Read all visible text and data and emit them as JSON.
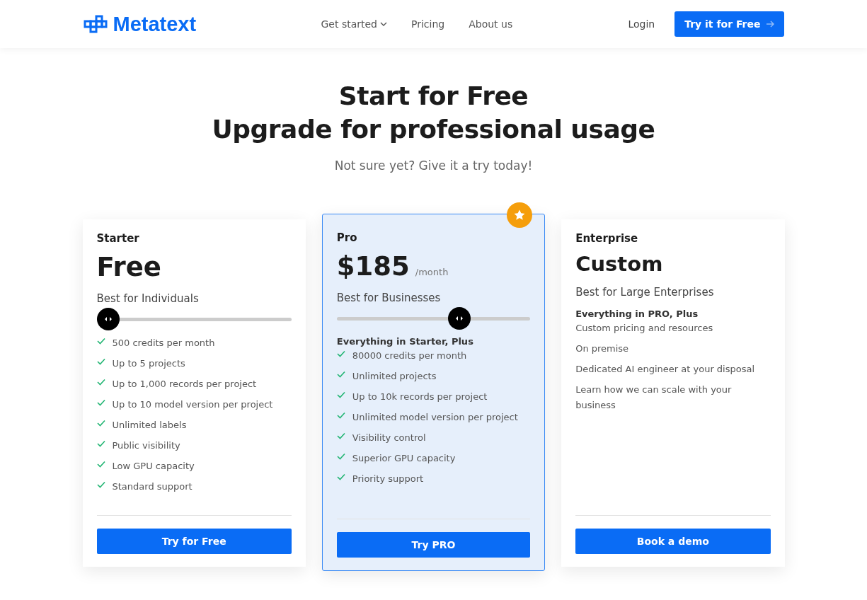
{
  "header": {
    "logo": "Metatext",
    "nav": [
      {
        "label": "Get started",
        "dropdown": true
      },
      {
        "label": "Pricing",
        "dropdown": false
      },
      {
        "label": "About us",
        "dropdown": false
      }
    ],
    "login": "Login",
    "cta": "Try it for Free"
  },
  "hero": {
    "title_lines": [
      "Start for Free",
      "Upgrade for professional usage"
    ],
    "subtitle": "Not sure yet? Give it a try today!"
  },
  "plans": [
    {
      "name": "Starter",
      "price": "Free",
      "kind": "priced",
      "featured": false,
      "audience": "Best for Individuals",
      "slider": {
        "level": 0
      },
      "features": [
        {
          "text": "500 credits per month",
          "checked": true
        },
        {
          "text": "Up to 5 projects",
          "checked": true
        },
        {
          "text": "Up to 1,000 records per project",
          "checked": true
        },
        {
          "text": "Up to 10 model version per project",
          "checked": true
        },
        {
          "text": "Unlimited labels",
          "checked": true
        },
        {
          "text": "Public visibility",
          "checked": true
        },
        {
          "text": "Low GPU capacity",
          "checked": true
        },
        {
          "text": "Standard support",
          "checked": true
        }
      ],
      "button": "Try for Free"
    },
    {
      "name": "Pro",
      "price": "$185",
      "period": "/month",
      "kind": "priced",
      "featured": true,
      "audience": "Best for Businesses",
      "slider": {
        "level": 0.65
      },
      "feature_heading": "Everything in Starter, Plus",
      "features": [
        {
          "text": "80000 credits per month",
          "checked": true
        },
        {
          "text": "Unlimited projects",
          "checked": true
        },
        {
          "text": "Up to 10k records per project",
          "checked": true
        },
        {
          "text": "Unlimited model version per project",
          "checked": true
        },
        {
          "text": "Visibility control",
          "checked": true
        },
        {
          "text": "Superior GPU capacity",
          "checked": true
        },
        {
          "text": "Priority support",
          "checked": true
        }
      ],
      "button": "Try PRO"
    },
    {
      "name": "Enterprise",
      "price": "Custom",
      "kind": "custom",
      "featured": false,
      "audience": "Best for Large Enterprises",
      "feature_heading": "Everything in PRO, Plus",
      "features": [
        {
          "text": "Custom pricing and resources",
          "checked": false
        },
        {
          "text": "On premise",
          "checked": false
        },
        {
          "text": "Dedicated AI engineer at your disposal",
          "checked": false
        },
        {
          "text": "Learn how we can scale with your business",
          "checked": false
        }
      ],
      "button": "Book a demo"
    }
  ]
}
